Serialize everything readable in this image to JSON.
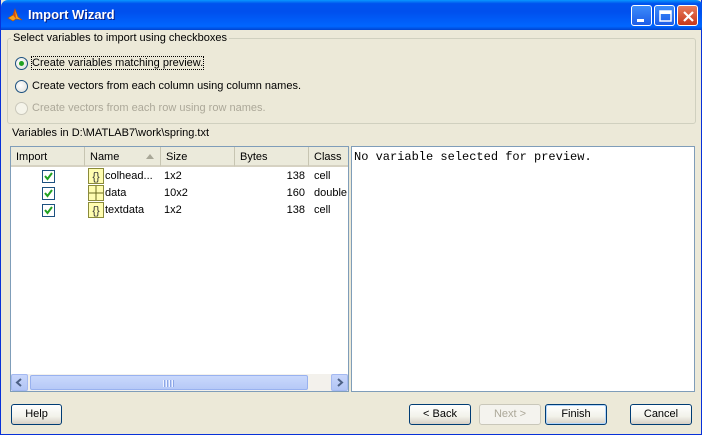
{
  "window": {
    "title": "Import Wizard",
    "app_icon": "matlab-icon"
  },
  "options": {
    "legend": "Select variables to import using checkboxes",
    "radio1": "Create variables matching preview.",
    "radio2": "Create vectors from each column using column names.",
    "radio3": "Create vectors from each row using row names."
  },
  "variables_label": "Variables in D:\\MATLAB7\\work\\spring.txt",
  "table": {
    "columns": [
      "Import",
      "Name",
      "Size",
      "Bytes",
      "Class"
    ],
    "rows": [
      {
        "name": "colhead...",
        "size": "1x2",
        "bytes": "138",
        "class": "cell",
        "icon": "cell-icon"
      },
      {
        "name": "data",
        "size": "10x2",
        "bytes": "160",
        "class": "double",
        "icon": "matrix-icon"
      },
      {
        "name": "textdata",
        "size": "1x2",
        "bytes": "138",
        "class": "cell",
        "icon": "cell-icon"
      }
    ]
  },
  "preview": {
    "text": "No variable selected for preview."
  },
  "buttons": {
    "help": "Help",
    "back": "< Back",
    "next": "Next >",
    "finish": "Finish",
    "cancel": "Cancel"
  }
}
